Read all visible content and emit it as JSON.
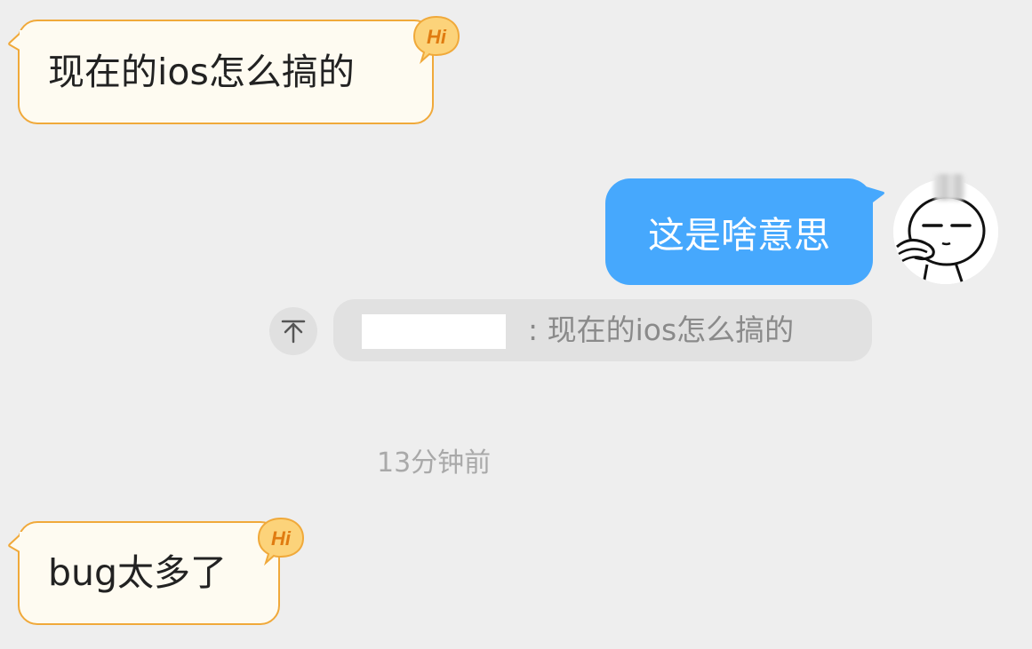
{
  "messages": [
    {
      "sender": "other",
      "text": "现在的ios怎么搞的",
      "badge": "Hi"
    },
    {
      "sender": "self",
      "text": "这是啥意思"
    },
    {
      "sender": "other",
      "text": "bug太多了",
      "badge": "Hi"
    }
  ],
  "quote": {
    "separator": ":",
    "text": "现在的ios怎么搞的",
    "author_redacted": true
  },
  "timestamp": "13分钟前",
  "icons": {
    "jump_to_quote": "arrow-up-to-top-icon",
    "badge": "hi-badge-icon",
    "avatar": "cartoon-face-avatar"
  },
  "colors": {
    "background": "#eeeeee",
    "incoming_bubble": "#fefbf1",
    "incoming_border": "#f0a93a",
    "outgoing_bubble": "#46a8fd",
    "quote_bg": "#e1e1e1",
    "timestamp": "#a9a9a9",
    "badge_fill": "#fcd37a",
    "badge_text": "#e07b10"
  }
}
